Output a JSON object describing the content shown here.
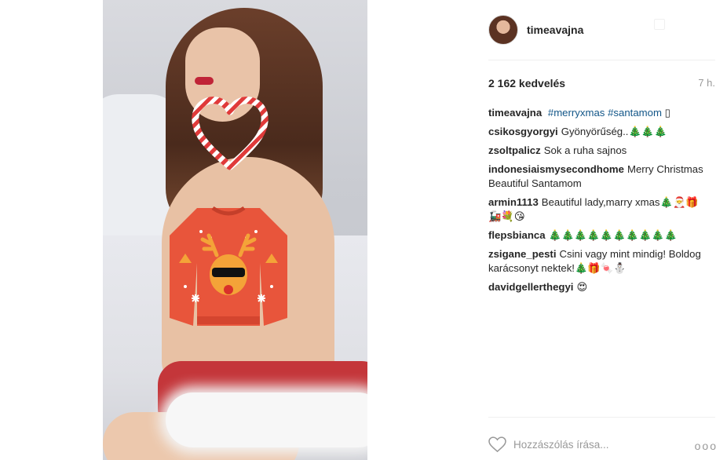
{
  "post": {
    "username": "timeavajna",
    "likes": "2 162 kedvelés",
    "time": "7 h.",
    "caption": {
      "author": "timeavajna",
      "tags": [
        "#merryxmas",
        "#santamom"
      ],
      "trailing": "▯"
    },
    "comments": [
      {
        "author": "csikosgyorgyi",
        "text": "Gyönyörűség..🎄🎄🎄"
      },
      {
        "author": "zsoltpalicz",
        "text": "Sok a ruha sajnos"
      },
      {
        "author": "indonesiaismysecondhome",
        "text": "Merry Christmas Beautiful Santamom"
      },
      {
        "author": "armin1113",
        "text": "Beautiful lady,marry xmas🎄🎅🎁🚂💐😘"
      },
      {
        "author": "flepsbianca",
        "text": "🎄🎄🎄🎄🎄🎄🎄🎄🎄🎄"
      },
      {
        "author": "zsigane_pesti",
        "text": "Csini vagy mint mindig! Boldog karácsonyt nektek!🎄🎁🍬⛄"
      },
      {
        "author": "davidgellerthegyi",
        "text": "😍"
      }
    ],
    "comment_placeholder": "Hozzászólás írása...",
    "more_label": "ooo"
  },
  "icons": {
    "like": "heart-outline-icon",
    "more": "more-options-icon",
    "sticker_heart": "candy-cane-heart-icon",
    "sticker_sweater": "reindeer-sweater-icon"
  },
  "colors": {
    "link": "#125688",
    "muted": "#999999",
    "sweater": "#e8553b"
  }
}
